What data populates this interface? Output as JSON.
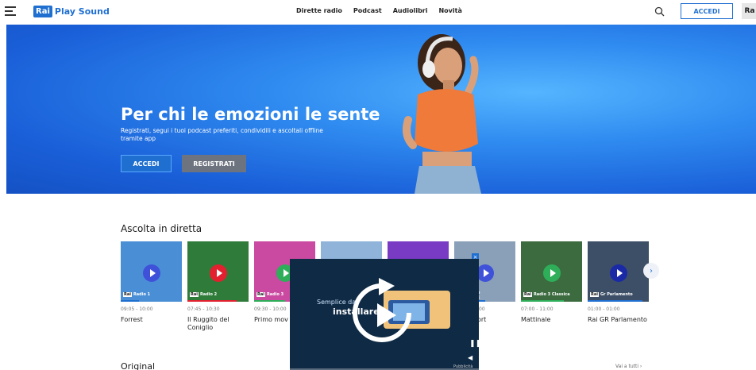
{
  "header": {
    "logo_rai": "Rai",
    "logo_text": "Play Sound",
    "nav": [
      "Dirette radio",
      "Podcast",
      "Audiolibri",
      "Novità"
    ],
    "login_label": "ACCEDI",
    "corner_label": "Ra"
  },
  "hero": {
    "title": "Per chi le emozioni le sente",
    "subtitle": "Registrati, segui i tuoi podcast preferiti, condividili e ascoltali offline tramite app",
    "accedi_label": "ACCEDI",
    "registrati_label": "REGISTRATI"
  },
  "live": {
    "title": "Ascolta in diretta",
    "cards": [
      {
        "rai": "Rai",
        "channel": "Radio 1",
        "time": "09:05 - 10:00",
        "show": "Forrest",
        "thumb_color": "#4a8fd6",
        "play_color": "#3f51d9",
        "bar_color": "#1f6fd1",
        "progress": 0.3
      },
      {
        "rai": "Rai",
        "channel": "Radio 2",
        "time": "07:45 - 10:30",
        "show": "Il Ruggito del Coniglio",
        "thumb_color": "#2f7b3a",
        "play_color": "#e3202f",
        "bar_color": "#e3202f",
        "progress": 0.8
      },
      {
        "rai": "Rai",
        "channel": "Radio 3",
        "time": "09:30 - 10:00",
        "show": "Primo mov",
        "thumb_color": "#c94aa0",
        "play_color": "#2fae5a",
        "bar_color": "#2fae5a",
        "progress": 0.5
      },
      {
        "rai": "",
        "channel": "",
        "time": "",
        "show": "",
        "thumb_color": "#8fb3d9",
        "play_color": "#1f6fd1",
        "bar_color": "#1f6fd1",
        "progress": 0.4
      },
      {
        "rai": "",
        "channel": "",
        "time": "",
        "show": "",
        "thumb_color": "#7a3bc4",
        "play_color": "#7a3bc4",
        "bar_color": "#7a3bc4",
        "progress": 0.4
      },
      {
        "rai": "",
        "channel": "",
        "time": "",
        "show": "",
        "thumb_color": "#8aa0b8",
        "play_color": "#3f51d9",
        "bar_color": "#1f6fd1",
        "progress": 0.5
      },
      {
        "rai": "Rai",
        "channel": "Radio 3 Classica",
        "time": "07:00 - 11:00",
        "show": "Mattinale",
        "thumb_color": "#3b6b3f",
        "play_color": "#2fae5a",
        "bar_color": "#2fae5a",
        "progress": 0.7
      },
      {
        "rai": "Rai",
        "channel": "Gr Parlamento",
        "time": "01:00 - 01:00",
        "show": "Rai GR Parlamento",
        "thumb_color": "#3d4f66",
        "play_color": "#1a2aa6",
        "bar_color": "#1f6fd1",
        "progress": 0.9
      }
    ],
    "partial_labels": {
      "card6_time": ":00",
      "card6_show": "ort",
      "card6_channel": "o 1"
    }
  },
  "video": {
    "text1": "Semplice da",
    "text2": "installare,",
    "ad_label": "Pubblicità"
  },
  "original": {
    "title": "Original",
    "see_all": "Vai a tutti ›"
  }
}
